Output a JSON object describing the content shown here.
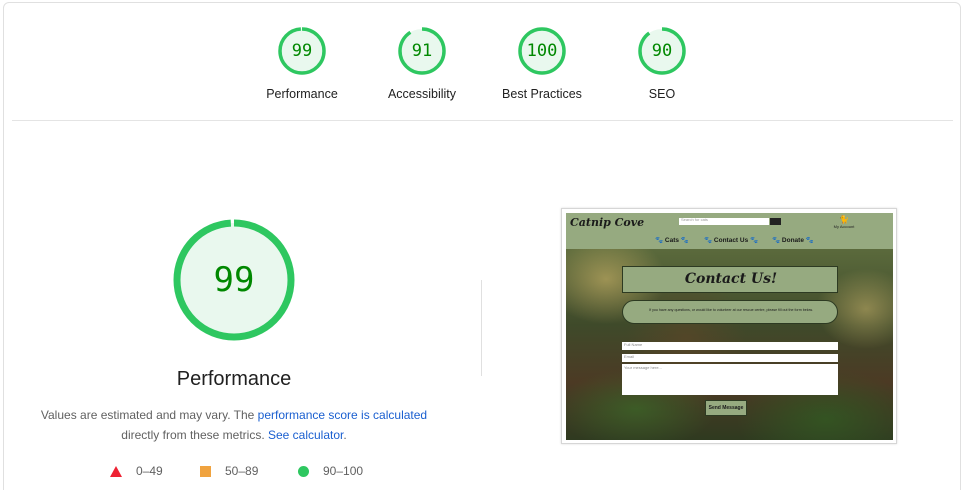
{
  "categories": [
    {
      "label": "Performance",
      "score": "99",
      "value": 99,
      "color": "#0cce6b"
    },
    {
      "label": "Accessibility",
      "score": "91",
      "value": 91,
      "color": "#0cce6b"
    },
    {
      "label": "Best Practices",
      "score": "100",
      "value": 100,
      "color": "#0cce6b"
    },
    {
      "label": "SEO",
      "score": "90",
      "value": 90,
      "color": "#0cce6b"
    }
  ],
  "main": {
    "score": "99",
    "value": 99,
    "title": "Performance",
    "desc_prefix": "Values are estimated and may vary. The ",
    "desc_link1": "performance score is calculated",
    "desc_middle": " directly from these metrics. ",
    "desc_link2": "See calculator",
    "desc_suffix": "."
  },
  "legend": [
    {
      "range": "0–49",
      "shape": "triangle",
      "color": "#ff3333"
    },
    {
      "range": "50–89",
      "shape": "square",
      "color": "#ffaa33"
    },
    {
      "range": "90–100",
      "shape": "circle",
      "color": "#0cce6b"
    }
  ],
  "screenshot": {
    "logo": "Catnip Cove",
    "search_placeholder": "Search for cats",
    "account_label": "My Account",
    "nav": [
      "🐾 Cats 🐾",
      "🐾 Contact Us 🐾",
      "🐾 Donate 🐾"
    ],
    "contact_title": "Contact Us!",
    "contact_text": "If you have any questions, or would like to volunteer at our rescue centre, please fill out the form below.",
    "fields": [
      "Full Name",
      "Email"
    ],
    "message_placeholder": "Your message here...",
    "send_button": "Send Message"
  }
}
